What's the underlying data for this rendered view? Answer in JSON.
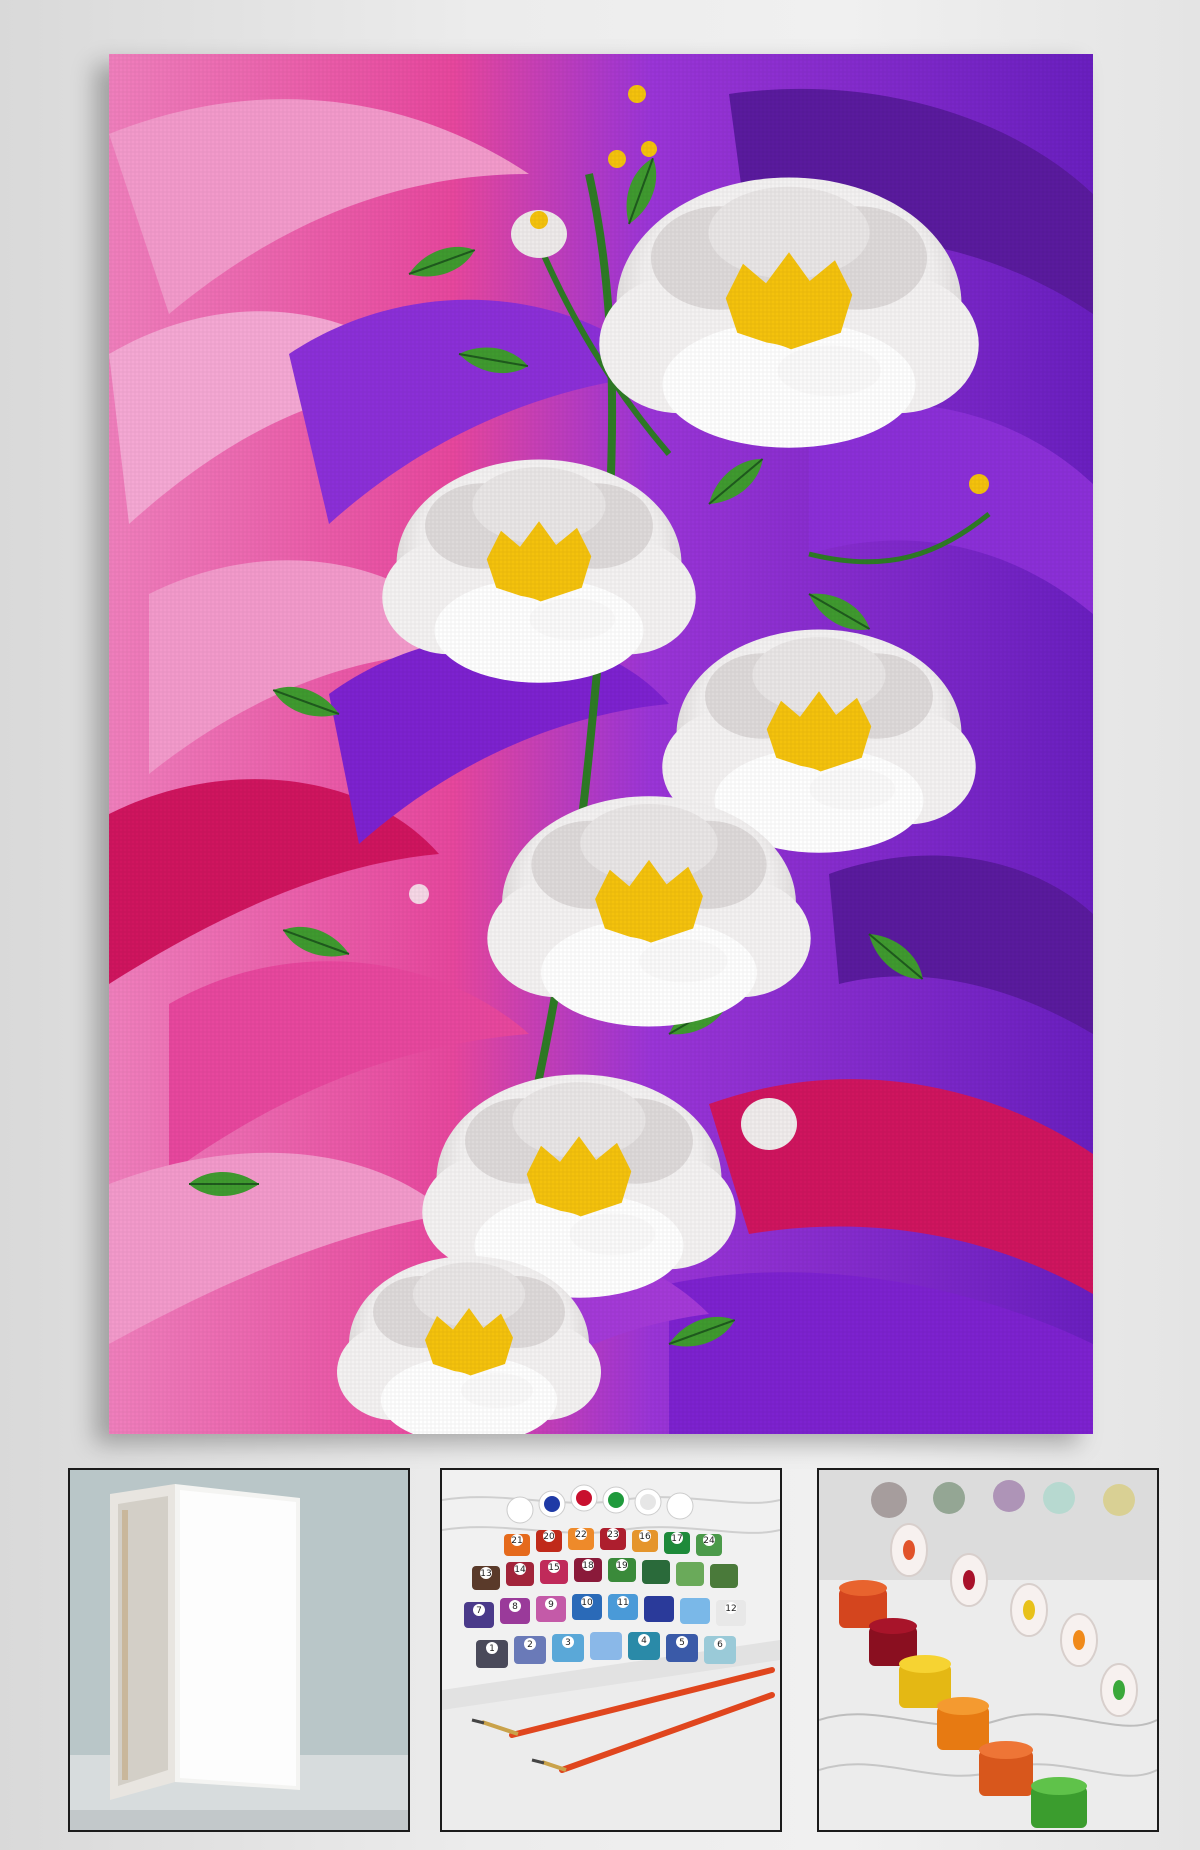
{
  "painting": {
    "subject": "white-peonies-on-pink-purple-swirl",
    "colors": {
      "pink": "#e8479e",
      "light_pink": "#f39acb",
      "magenta": "#d0155f",
      "purple": "#7d22d0",
      "deep_purple": "#5a1a9e",
      "petal": "#ffffff",
      "petal_shade": "#d8d4d4",
      "center": "#f4c20d",
      "leaf": "#3f9a2f",
      "dark_leaf": "#1f5a1e"
    }
  },
  "thumbnails": [
    {
      "subject": "blank-stretched-canvas"
    },
    {
      "subject": "numbered-paint-pots-and-brushes"
    },
    {
      "subject": "open-paint-pots-closeup"
    }
  ],
  "paint_pot_numbers": [
    "1",
    "2",
    "3",
    "4",
    "5",
    "6",
    "7",
    "8",
    "9",
    "10",
    "11",
    "12",
    "13",
    "14",
    "15",
    "16",
    "17",
    "18",
    "19",
    "20",
    "21",
    "22",
    "23",
    "24"
  ]
}
